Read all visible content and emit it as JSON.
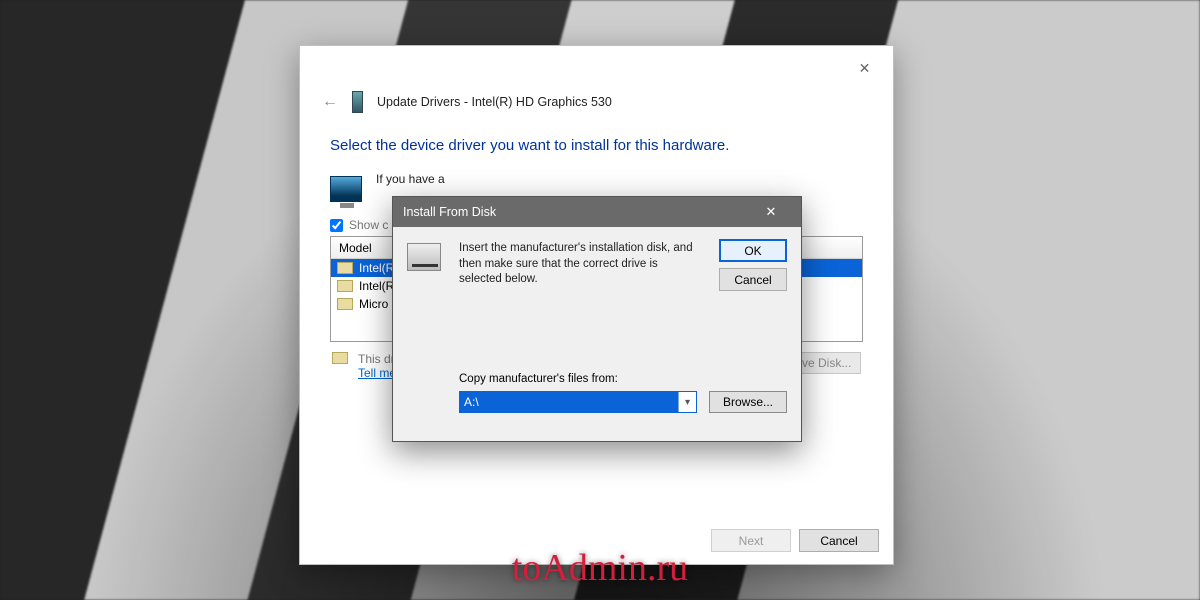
{
  "wizard": {
    "title": "Update Drivers - Intel(R) HD Graphics 530",
    "instruction": "Select the device driver you want to install for this hardware.",
    "info_text_tail": "If you have a",
    "show_compatible_label": "Show c",
    "model_header": "Model",
    "items": [
      {
        "label": "Intel(R",
        "selected": true
      },
      {
        "label": "Intel(R",
        "selected": false
      },
      {
        "label": "Micro",
        "selected": false
      }
    ],
    "signed_msg": "This driver is digitally signed.",
    "signing_link": "Tell me why driver signing is important",
    "have_disk": "Have Disk...",
    "next": "Next",
    "cancel": "Cancel"
  },
  "modal": {
    "title": "Install From Disk",
    "message": "Insert the manufacturer's installation disk, and then make sure that the correct drive is selected below.",
    "ok": "OK",
    "cancel": "Cancel",
    "copy_label": "Copy manufacturer's files from:",
    "path_value": "A:\\",
    "browse": "Browse..."
  },
  "watermark": "toAdmin.ru"
}
